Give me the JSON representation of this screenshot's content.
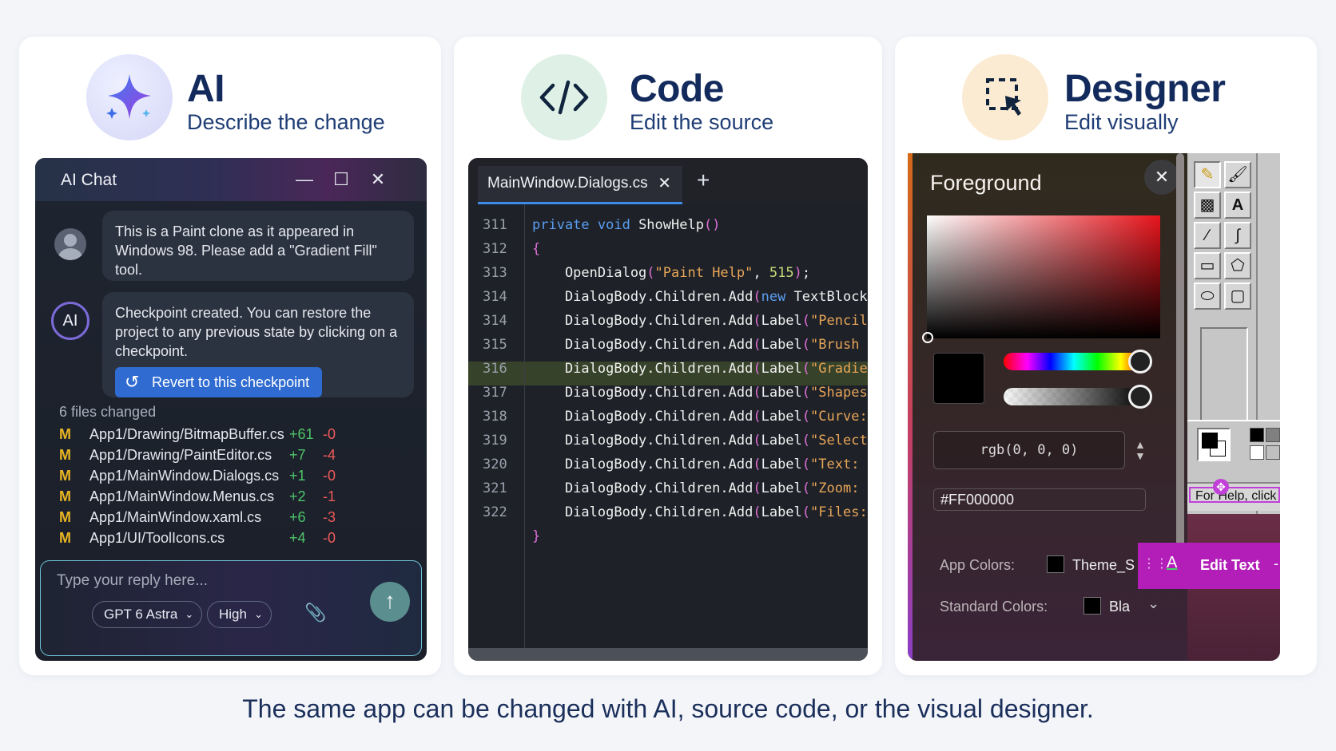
{
  "ai": {
    "title": "AI",
    "subtitle": "Describe the change",
    "window_title": "AI Chat",
    "user_message": "This is a Paint clone as it appeared in Windows 98. Please add a \"Gradient Fill\" tool.",
    "assistant_avatar": "AI",
    "assistant_message": "Checkpoint created. You can restore the project to any previous state by clicking on a checkpoint.",
    "revert_label": "Revert to this checkpoint",
    "files_changed_label": "6 files changed",
    "files": [
      {
        "status": "M",
        "path": "App1/Drawing/BitmapBuffer.cs",
        "added": "+61",
        "removed": "-0"
      },
      {
        "status": "M",
        "path": "App1/Drawing/PaintEditor.cs",
        "added": "+7",
        "removed": "-4"
      },
      {
        "status": "M",
        "path": "App1/MainWindow.Dialogs.cs",
        "added": "+1",
        "removed": "-0"
      },
      {
        "status": "M",
        "path": "App1/MainWindow.Menus.cs",
        "added": "+2",
        "removed": "-1"
      },
      {
        "status": "M",
        "path": "App1/MainWindow.xaml.cs",
        "added": "+6",
        "removed": "-3"
      },
      {
        "status": "M",
        "path": "App1/UI/ToolIcons.cs",
        "added": "+4",
        "removed": "-0"
      }
    ],
    "reply_placeholder": "Type your reply here...",
    "model": "GPT 6 Astra",
    "effort": "High"
  },
  "code": {
    "title": "Code",
    "subtitle": "Edit the source",
    "tab_label": "MainWindow.Dialogs.cs",
    "highlighted_line": "316",
    "lines": [
      {
        "n": "311",
        "parts": [
          {
            "t": "private void ",
            "c": "kw"
          },
          {
            "t": "ShowHelp",
            "c": "fn"
          },
          {
            "t": "()",
            "c": "pr"
          }
        ]
      },
      {
        "n": "312",
        "parts": [
          {
            "t": "{",
            "c": "pr"
          }
        ]
      },
      {
        "n": "313",
        "parts": [
          {
            "t": "    OpenDialog",
            "c": "fn"
          },
          {
            "t": "(",
            "c": "pr"
          },
          {
            "t": "\"Paint Help\"",
            "c": "str"
          },
          {
            "t": ", ",
            "c": "fn"
          },
          {
            "t": "515",
            "c": "num"
          },
          {
            "t": ")",
            "c": "pr"
          },
          {
            "t": ";",
            "c": "fn"
          }
        ]
      },
      {
        "n": "314",
        "parts": [
          {
            "t": "    DialogBody.Children.Add",
            "c": "fn"
          },
          {
            "t": "(",
            "c": "pr"
          },
          {
            "t": "new ",
            "c": "kw"
          },
          {
            "t": "TextBlock",
            "c": "fn"
          }
        ]
      },
      {
        "n": "314",
        "parts": [
          {
            "t": "    DialogBody.Children.Add",
            "c": "fn"
          },
          {
            "t": "(",
            "c": "pr"
          },
          {
            "t": "Label",
            "c": "fn"
          },
          {
            "t": "(",
            "c": "pr"
          },
          {
            "t": "\"Pencil,",
            "c": "str"
          }
        ]
      },
      {
        "n": "315",
        "parts": [
          {
            "t": "    DialogBody.Children.Add",
            "c": "fn"
          },
          {
            "t": "(",
            "c": "pr"
          },
          {
            "t": "Label",
            "c": "fn"
          },
          {
            "t": "(",
            "c": "pr"
          },
          {
            "t": "\"Brush a",
            "c": "str"
          }
        ]
      },
      {
        "n": "316",
        "parts": [
          {
            "t": "    DialogBody.Children.Add",
            "c": "fn"
          },
          {
            "t": "(",
            "c": "pr"
          },
          {
            "t": "Label",
            "c": "fn"
          },
          {
            "t": "(",
            "c": "pr"
          },
          {
            "t": "\"Gradient",
            "c": "str"
          }
        ]
      },
      {
        "n": "317",
        "parts": [
          {
            "t": "    DialogBody.Children.Add",
            "c": "fn"
          },
          {
            "t": "(",
            "c": "pr"
          },
          {
            "t": "Label",
            "c": "fn"
          },
          {
            "t": "(",
            "c": "pr"
          },
          {
            "t": "\"Shapes: ",
            "c": "str"
          }
        ]
      },
      {
        "n": "318",
        "parts": [
          {
            "t": "    DialogBody.Children.Add",
            "c": "fn"
          },
          {
            "t": "(",
            "c": "pr"
          },
          {
            "t": "Label",
            "c": "fn"
          },
          {
            "t": "(",
            "c": "pr"
          },
          {
            "t": "\"Curve: c",
            "c": "str"
          }
        ]
      },
      {
        "n": "319",
        "parts": [
          {
            "t": "    DialogBody.Children.Add",
            "c": "fn"
          },
          {
            "t": "(",
            "c": "pr"
          },
          {
            "t": "Label",
            "c": "fn"
          },
          {
            "t": "(",
            "c": "pr"
          },
          {
            "t": "\"Select c",
            "c": "str"
          }
        ]
      },
      {
        "n": "320",
        "parts": [
          {
            "t": "    DialogBody.Children.Add",
            "c": "fn"
          },
          {
            "t": "(",
            "c": "pr"
          },
          {
            "t": "Label",
            "c": "fn"
          },
          {
            "t": "(",
            "c": "pr"
          },
          {
            "t": "\"Text: dr",
            "c": "str"
          }
        ]
      },
      {
        "n": "321",
        "parts": [
          {
            "t": "    DialogBody.Children.Add",
            "c": "fn"
          },
          {
            "t": "(",
            "c": "pr"
          },
          {
            "t": "Label",
            "c": "fn"
          },
          {
            "t": "(",
            "c": "pr"
          },
          {
            "t": "\"Zoom: us",
            "c": "str"
          }
        ]
      },
      {
        "n": "322",
        "parts": [
          {
            "t": "    DialogBody.Children.Add",
            "c": "fn"
          },
          {
            "t": "(",
            "c": "pr"
          },
          {
            "t": "Label",
            "c": "fn"
          },
          {
            "t": "(",
            "c": "pr"
          },
          {
            "t": "\"Files: c",
            "c": "str"
          }
        ]
      },
      {
        "n": "",
        "parts": [
          {
            "t": "}",
            "c": "pr"
          }
        ]
      }
    ]
  },
  "designer": {
    "title": "Designer",
    "subtitle": "Edit visually",
    "panel_title": "Foreground",
    "rgb_value": "rgb(0, 0, 0)",
    "hex_value": "#FF000000",
    "app_colors_label": "App Colors:",
    "app_colors_value": "Theme_S",
    "standard_colors_label": "Standard Colors:",
    "standard_colors_value": "Bla",
    "status_text": "For Help, click",
    "edit_text_label": "Edit Text",
    "edit_text_icon": "A",
    "edit_text_more": "-"
  },
  "caption": "The same app can be changed with AI, source code, or the visual designer.",
  "colors": {
    "accent_blue": "#2f6bd0",
    "added_green": "#4fc46a",
    "removed_red": "#ef5a5a",
    "modified_yellow": "#e8b522",
    "edit_bar_magenta": "#b31eb8"
  }
}
